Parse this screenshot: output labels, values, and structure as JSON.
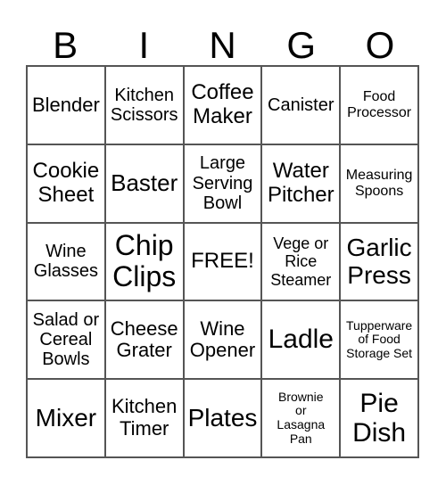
{
  "header": [
    "B",
    "I",
    "N",
    "G",
    "O"
  ],
  "cells": [
    [
      "Blender",
      "Kitchen\nScissors",
      "Coffee\nMaker",
      "Canister",
      "Food\nProcessor"
    ],
    [
      "Cookie\nSheet",
      "Baster",
      "Large\nServing\nBowl",
      "Water\nPitcher",
      "Measuring\nSpoons"
    ],
    [
      "Wine\nGlasses",
      "Chip\nClips",
      "FREE!",
      "Vege or\nRice\nSteamer",
      "Garlic\nPress"
    ],
    [
      "Salad or\nCereal\nBowls",
      "Cheese\nGrater",
      "Wine\nOpener",
      "Ladle",
      "Tupperware\nof Food\nStorage Set"
    ],
    [
      "Mixer",
      "Kitchen\nTimer",
      "Plates",
      "Brownie\nor\nLasagna\nPan",
      "Pie\nDish"
    ]
  ]
}
